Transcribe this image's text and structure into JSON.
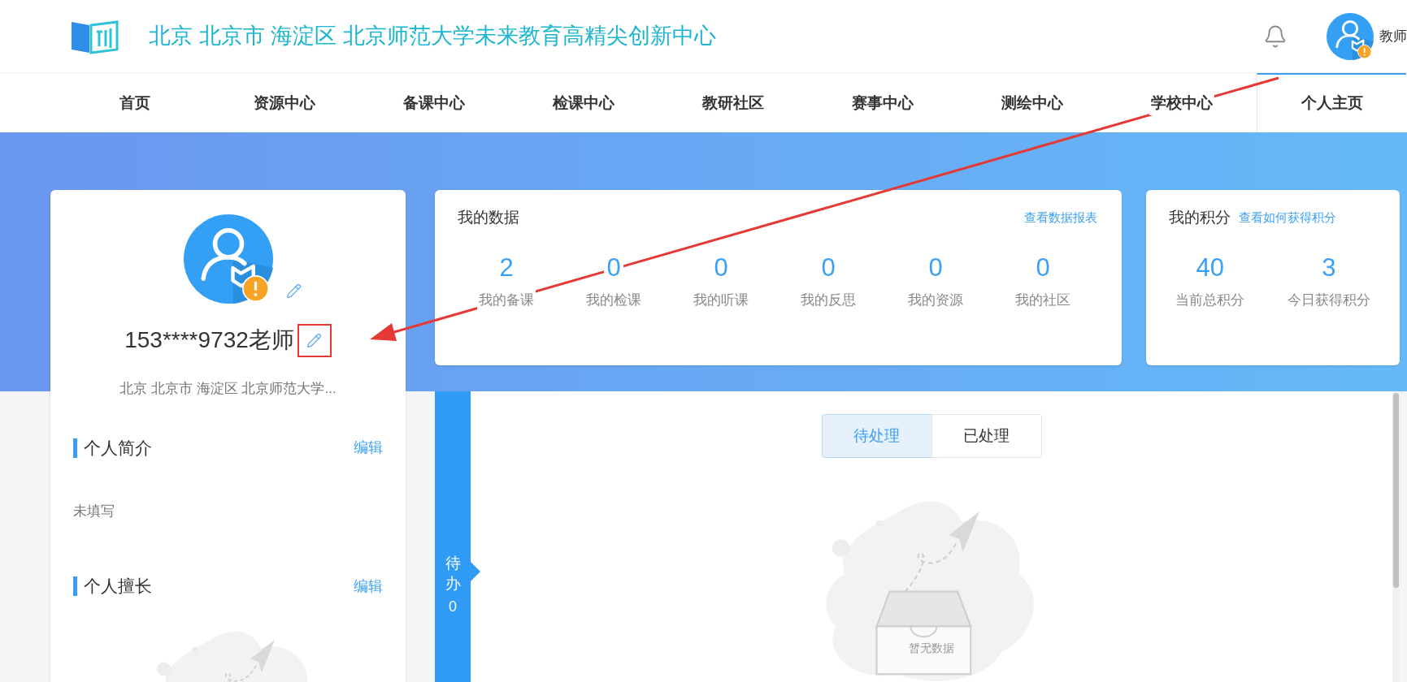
{
  "header": {
    "title": "北京 北京市 海淀区 北京师范大学未来教育高精尖创新中心",
    "user": {
      "name": "教师",
      "warning": true
    }
  },
  "nav": [
    {
      "label": "首页",
      "selected": false
    },
    {
      "label": "资源中心",
      "selected": false
    },
    {
      "label": "备课中心",
      "selected": false
    },
    {
      "label": "检课中心",
      "selected": false
    },
    {
      "label": "教研社区",
      "selected": false
    },
    {
      "label": "赛事中心",
      "selected": false
    },
    {
      "label": "测绘中心",
      "selected": false
    },
    {
      "label": "学校中心",
      "selected": false
    },
    {
      "label": "个人主页",
      "selected": true
    }
  ],
  "profile": {
    "name": "153****9732老师",
    "org": "北京 北京市 海淀区 北京师范大学...",
    "warning": true,
    "sections": [
      {
        "title": "个人简介",
        "action": "编辑",
        "content": "未填写"
      },
      {
        "title": "个人擅长",
        "action": "编辑"
      }
    ]
  },
  "my_data": {
    "title": "我的数据",
    "link": "查看数据报表",
    "stats": [
      {
        "value": "2",
        "label": "我的备课"
      },
      {
        "value": "0",
        "label": "我的检课"
      },
      {
        "value": "0",
        "label": "我的听课"
      },
      {
        "value": "0",
        "label": "我的反思"
      },
      {
        "value": "0",
        "label": "我的资源"
      },
      {
        "value": "0",
        "label": "我的社区"
      }
    ]
  },
  "my_points": {
    "title": "我的积分",
    "link": "查看如何获得积分",
    "stats": [
      {
        "value": "40",
        "label": "当前总积分"
      },
      {
        "value": "3",
        "label": "今日获得积分"
      }
    ]
  },
  "todo": {
    "label": "待办",
    "count": "0",
    "tabs": [
      {
        "label": "待处理",
        "selected": true
      },
      {
        "label": "已处理",
        "selected": false
      }
    ],
    "empty_text": "暂无数据"
  }
}
